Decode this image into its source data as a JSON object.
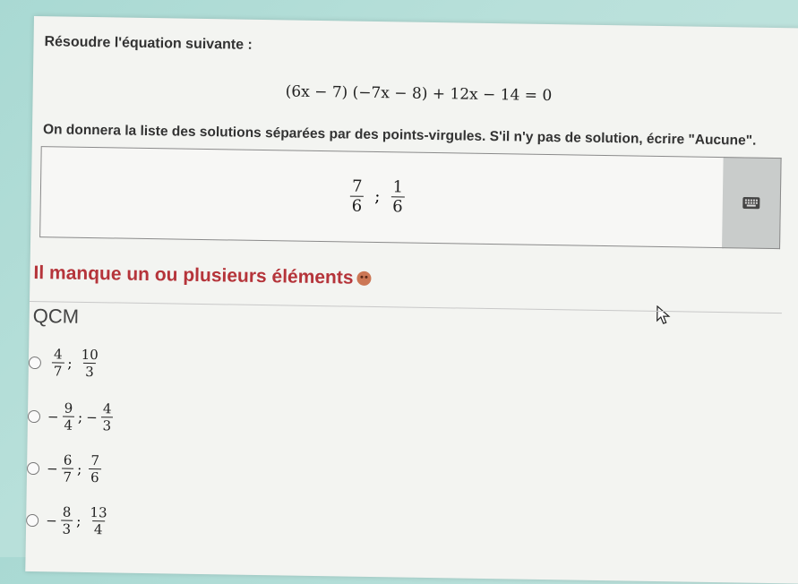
{
  "question": {
    "prompt": "Résoudre l'équation suivante :",
    "equation": "(6x − 7) (−7x − 8) + 12x − 14 = 0",
    "instruction": "On donnera la liste des solutions séparées par des points-virgules. S'il n'y pas de solution, écrire \"Aucune\"."
  },
  "answer": {
    "fractions": [
      {
        "num": "7",
        "den": "6"
      },
      {
        "num": "1",
        "den": "6"
      }
    ],
    "separator": ";",
    "keyboard_icon": "keyboard-icon"
  },
  "feedback": {
    "text": "Il manque un ou plusieurs éléments",
    "icon": "sad-face-icon",
    "color": "#b5343a"
  },
  "qcm": {
    "title": "QCM",
    "options": [
      {
        "a_sign": "",
        "a_num": "4",
        "a_den": "7",
        "b_sign": "",
        "b_num": "10",
        "b_den": "3"
      },
      {
        "a_sign": "−",
        "a_num": "9",
        "a_den": "4",
        "b_sign": "−",
        "b_num": "4",
        "b_den": "3"
      },
      {
        "a_sign": "−",
        "a_num": "6",
        "a_den": "7",
        "b_sign": "",
        "b_num": "7",
        "b_den": "6"
      },
      {
        "a_sign": "−",
        "a_num": "8",
        "a_den": "3",
        "b_sign": "",
        "b_num": "13",
        "b_den": "4"
      }
    ]
  }
}
